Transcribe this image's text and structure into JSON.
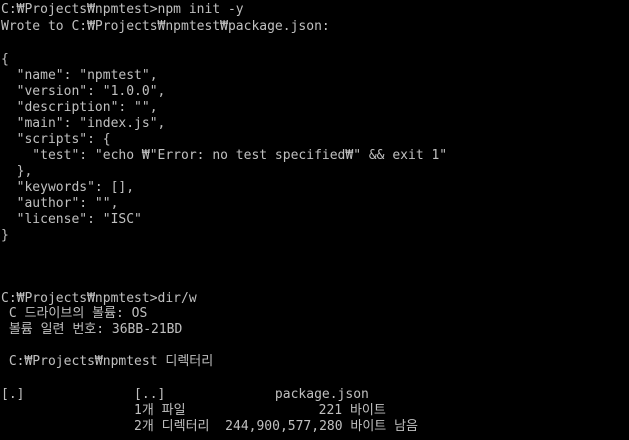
{
  "colors": {
    "background": "#000000",
    "text": "#c0c0c0"
  },
  "console": {
    "lines": [
      "C:₩Projects₩npmtest>npm init -y",
      "Wrote to C:₩Projects₩npmtest₩package.json:",
      "",
      "{",
      "  \"name\": \"npmtest\",",
      "  \"version\": \"1.0.0\",",
      "  \"description\": \"\",",
      "  \"main\": \"index.js\",",
      "  \"scripts\": {",
      "    \"test\": \"echo ₩\"Error: no test specified₩\" && exit 1\"",
      "  },",
      "  \"keywords\": [],",
      "  \"author\": \"\",",
      "  \"license\": \"ISC\"",
      "}",
      "",
      "",
      "",
      "C:₩Projects₩npmtest>dir/w",
      " C 드라이브의 볼륨: OS",
      " 볼륨 일련 번호: 36BB-21BD",
      "",
      " C:₩Projects₩npmtest 디렉터리",
      "",
      "[.]              [..]              package.json",
      "                 1개 파일                 221 바이트",
      "                 2개 디렉터리  244,900,577,280 바이트 남음"
    ]
  }
}
